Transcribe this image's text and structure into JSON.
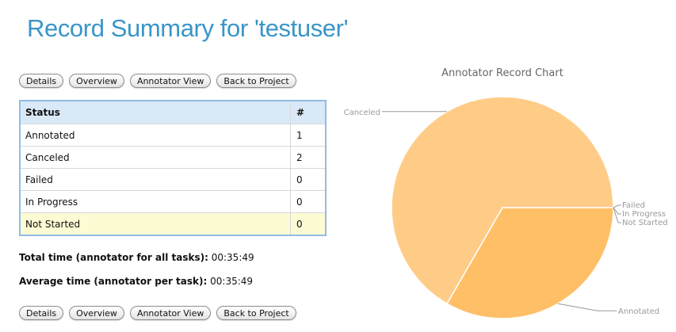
{
  "page": {
    "title": "Record Summary for 'testuser'"
  },
  "buttons": {
    "details": "Details",
    "overview": "Overview",
    "annotator_view": "Annotator View",
    "back_to_project": "Back to Project"
  },
  "status_table": {
    "header_status": "Status",
    "header_count": "#",
    "rows": [
      {
        "status": "Annotated",
        "count": "1"
      },
      {
        "status": "Canceled",
        "count": "2"
      },
      {
        "status": "Failed",
        "count": "0"
      },
      {
        "status": "In Progress",
        "count": "0"
      },
      {
        "status": "Not Started",
        "count": "0"
      }
    ]
  },
  "stats": {
    "total_label": "Total time (annotator for all tasks):",
    "total_value": "00:35:49",
    "avg_label": "Average time (annotator per task):",
    "avg_value": "00:35:49"
  },
  "colors": {
    "title": "#3a95c8",
    "canceled_slice": "#ffcc88",
    "annotated_slice": "#ffbf66"
  },
  "chart_data": {
    "type": "pie",
    "title": "Annotator Record Chart",
    "categories": [
      "Annotated",
      "Canceled",
      "Failed",
      "In Progress",
      "Not Started"
    ],
    "values": [
      1,
      2,
      0,
      0,
      0
    ],
    "legend": "none"
  }
}
